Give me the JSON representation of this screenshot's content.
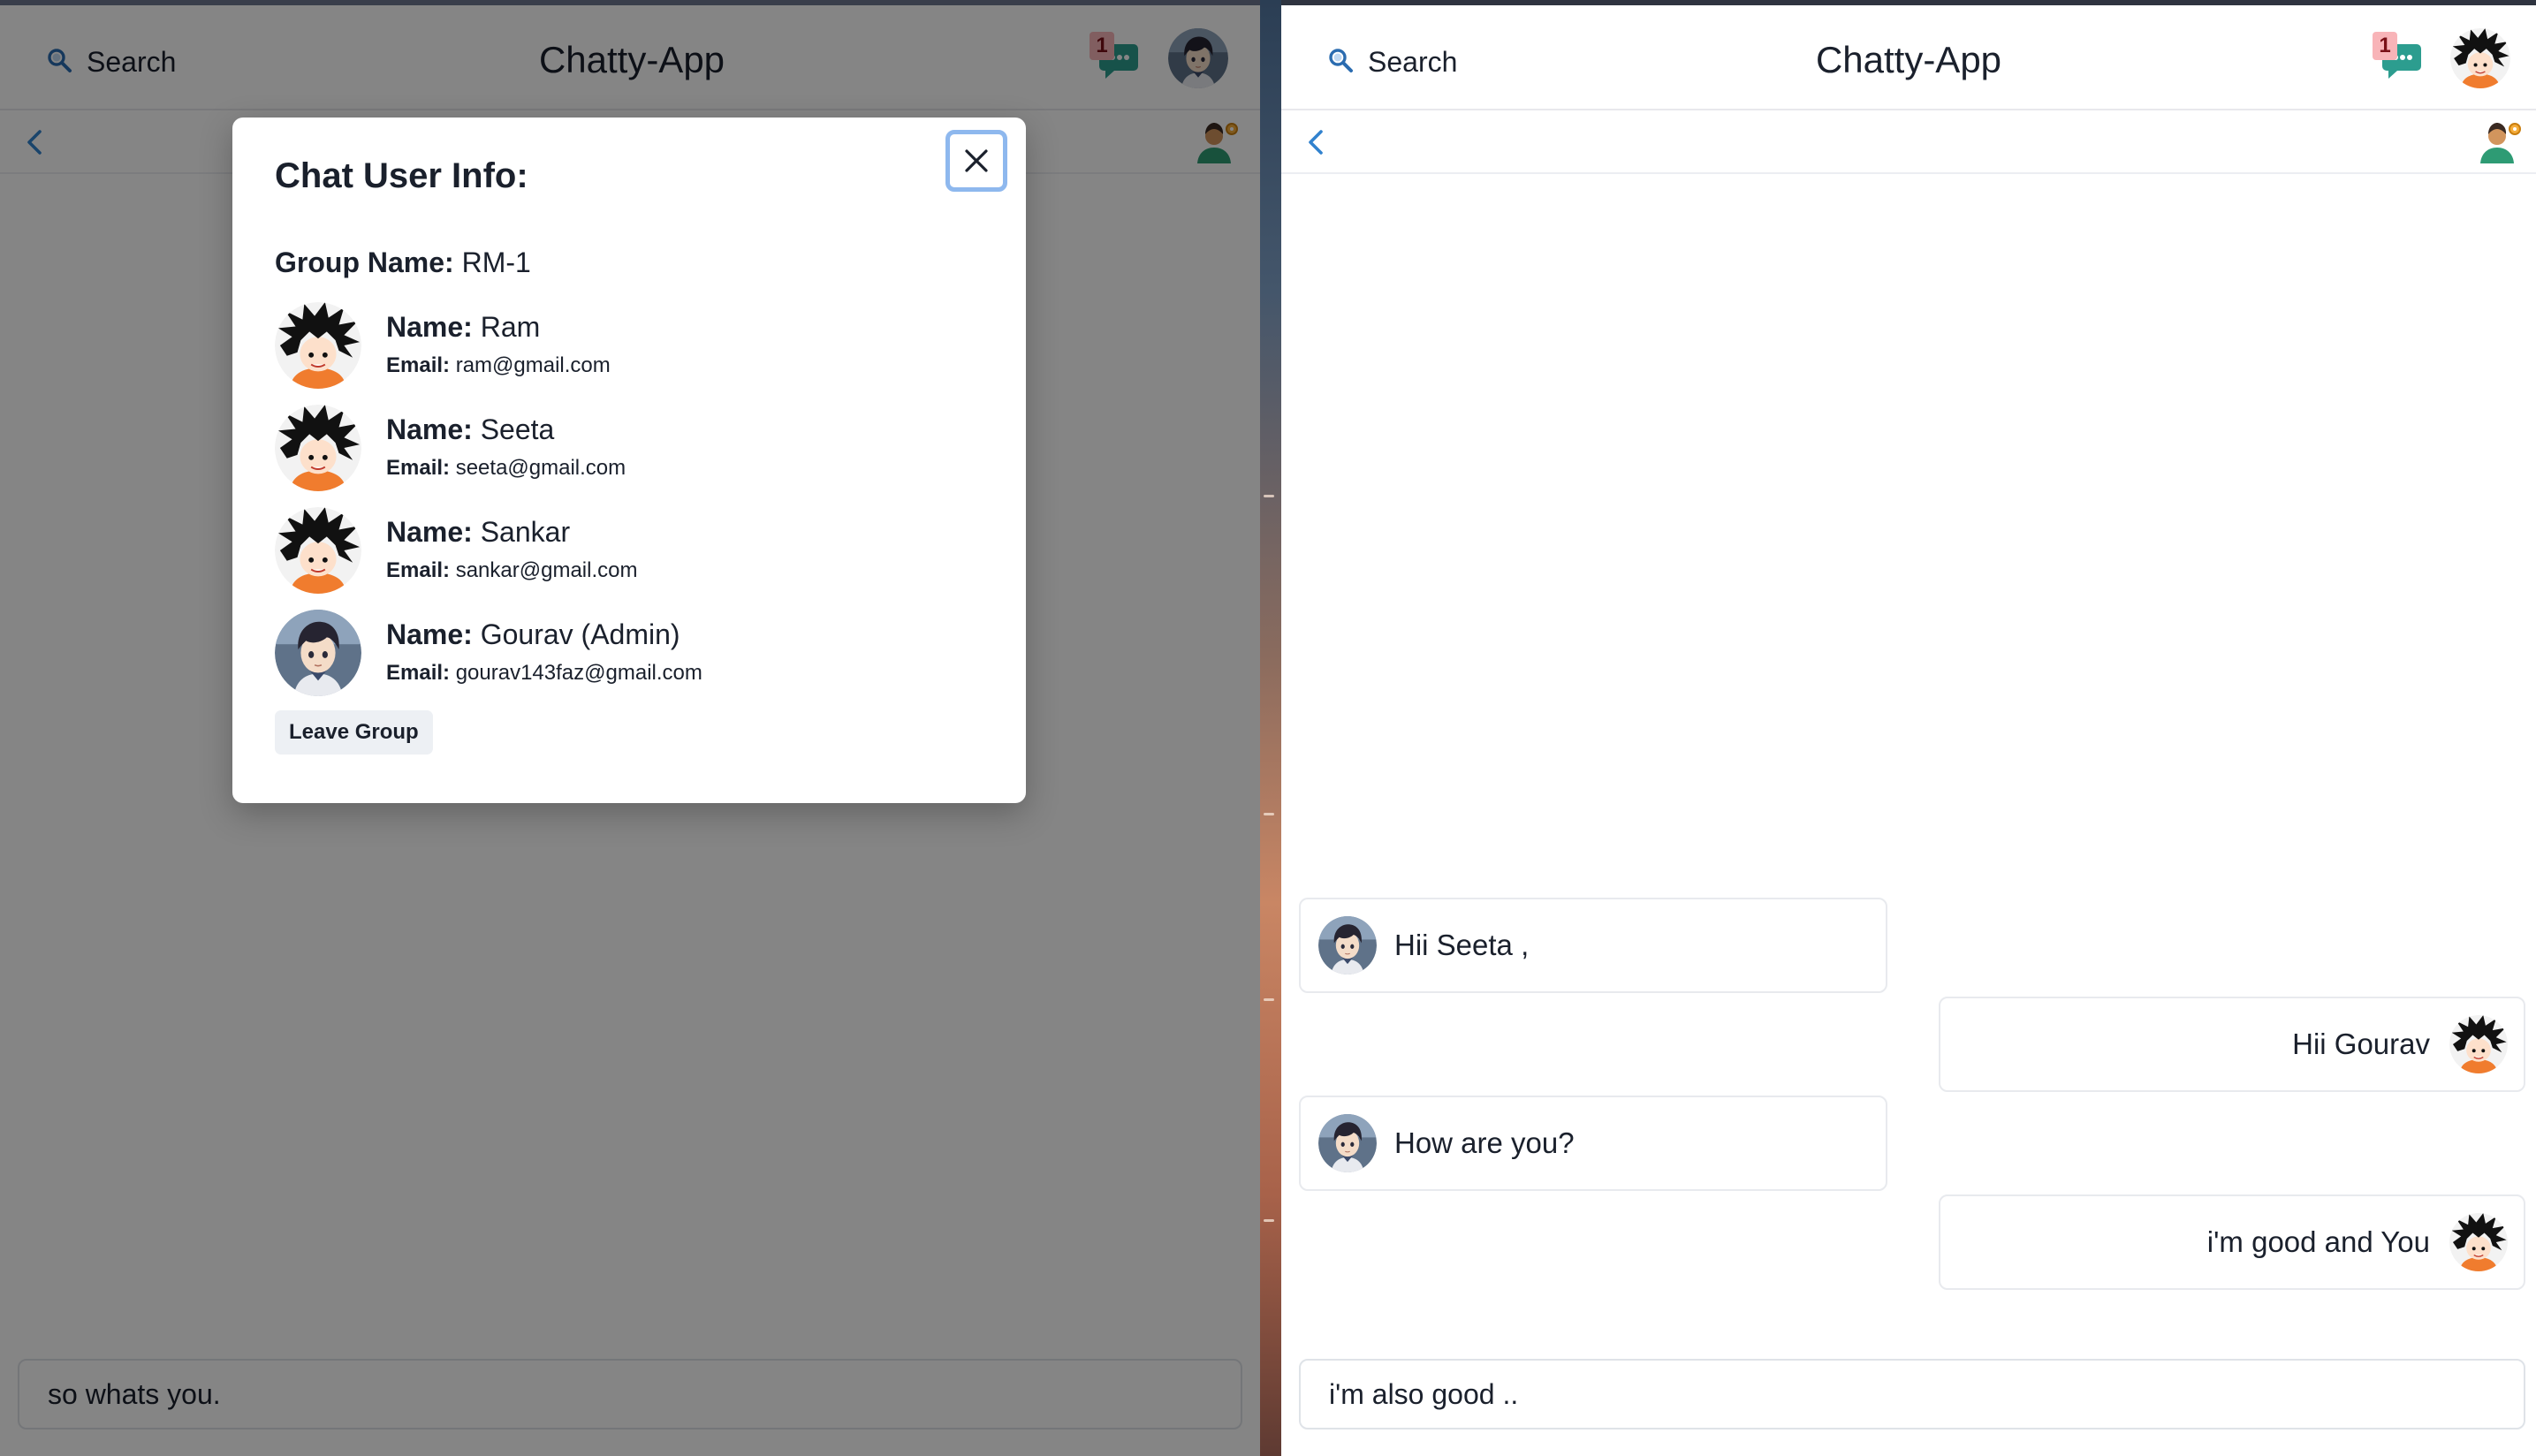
{
  "colors": {
    "accent": "#3182ce",
    "chat_icon": "#2c9d8f",
    "badge_bg": "#f8b4b8",
    "overlay": "rgba(0,0,0,0.48)"
  },
  "left_window": {
    "header": {
      "search_label": "Search",
      "search_icon": "search-icon",
      "app_title": "Chatty-App",
      "notification_count": "1",
      "notification_icon": "chat-bubble-icon"
    },
    "composer": {
      "value": "so whats you."
    },
    "modal": {
      "title": "Chat User Info:",
      "group_name_label": "Group Name:",
      "group_name": "RM-1",
      "close_icon": "close-icon",
      "members": [
        {
          "name_label": "Name:",
          "name": "Ram",
          "email_label": "Email:",
          "email": "ram@gmail.com",
          "avatar": "spiky-hair-avatar"
        },
        {
          "name_label": "Name:",
          "name": "Seeta",
          "email_label": "Email:",
          "email": "seeta@gmail.com",
          "avatar": "spiky-hair-avatar"
        },
        {
          "name_label": "Name:",
          "name": "Sankar",
          "email_label": "Email:",
          "email": "sankar@gmail.com",
          "avatar": "spiky-hair-avatar"
        },
        {
          "name_label": "Name:",
          "name": "Gourav (Admin)",
          "email_label": "Email:",
          "email": "gourav143faz@gmail.com",
          "avatar": "anime-boy-avatar"
        }
      ],
      "leave_button": "Leave Group"
    }
  },
  "right_window": {
    "header": {
      "search_label": "Search",
      "search_icon": "search-icon",
      "app_title": "Chatty-App",
      "notification_count": "1",
      "notification_icon": "chat-bubble-icon"
    },
    "messages": [
      {
        "side": "left",
        "text": "Hii Seeta ,",
        "avatar": "anime-boy-avatar"
      },
      {
        "side": "right",
        "text": "Hii Gourav",
        "avatar": "spiky-hair-avatar"
      },
      {
        "side": "left",
        "text": "How are you?",
        "avatar": "anime-boy-avatar"
      },
      {
        "side": "right",
        "text": "i'm good and You",
        "avatar": "spiky-hair-avatar"
      }
    ],
    "composer": {
      "value": "i'm also good .."
    }
  }
}
